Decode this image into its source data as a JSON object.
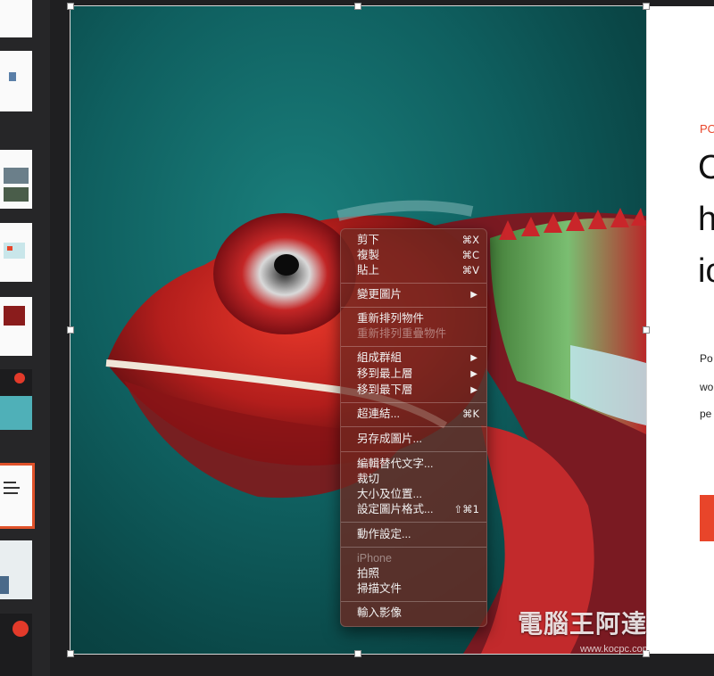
{
  "slide_right": {
    "tag": "PO",
    "heading_lines": [
      "C",
      "h",
      "io"
    ],
    "body_lines": [
      "Po",
      "wo",
      "pe"
    ]
  },
  "context_menu": {
    "items": [
      {
        "label": "剪下",
        "shortcut": "⌘X",
        "enabled": true
      },
      {
        "label": "複製",
        "shortcut": "⌘C",
        "enabled": true
      },
      {
        "label": "貼上",
        "shortcut": "⌘V",
        "enabled": true
      },
      {
        "label": "變更圖片",
        "submenu": true,
        "enabled": true
      },
      {
        "label": "重新排列物件",
        "enabled": true
      },
      {
        "label": "重新排列重疊物件",
        "enabled": false
      },
      {
        "label": "組成群組",
        "submenu": true,
        "enabled": true
      },
      {
        "label": "移到最上層",
        "submenu": true,
        "enabled": true
      },
      {
        "label": "移到最下層",
        "submenu": true,
        "enabled": true
      },
      {
        "label": "超連結...",
        "shortcut": "⌘K",
        "enabled": true
      },
      {
        "label": "另存成圖片...",
        "enabled": true
      },
      {
        "label": "編輯替代文字...",
        "enabled": true
      },
      {
        "label": "裁切",
        "enabled": true
      },
      {
        "label": "大小及位置...",
        "enabled": true
      },
      {
        "label": "設定圖片格式...",
        "shortcut": "⇧⌘1",
        "enabled": true
      },
      {
        "label": "動作設定...",
        "enabled": true
      },
      {
        "label": "iPhone",
        "enabled": false
      },
      {
        "label": "拍照",
        "enabled": true
      },
      {
        "label": "掃描文件",
        "enabled": true
      },
      {
        "label": "輸入影像",
        "enabled": true
      }
    ],
    "submenu_arrow": "▶"
  },
  "watermark": {
    "text": "電腦王阿達",
    "url": "www.kocpc.com.tw"
  },
  "colors": {
    "accent": "#e8452a",
    "menu_bg": "#6e2820",
    "photo_bg": "#0f5f5f"
  }
}
